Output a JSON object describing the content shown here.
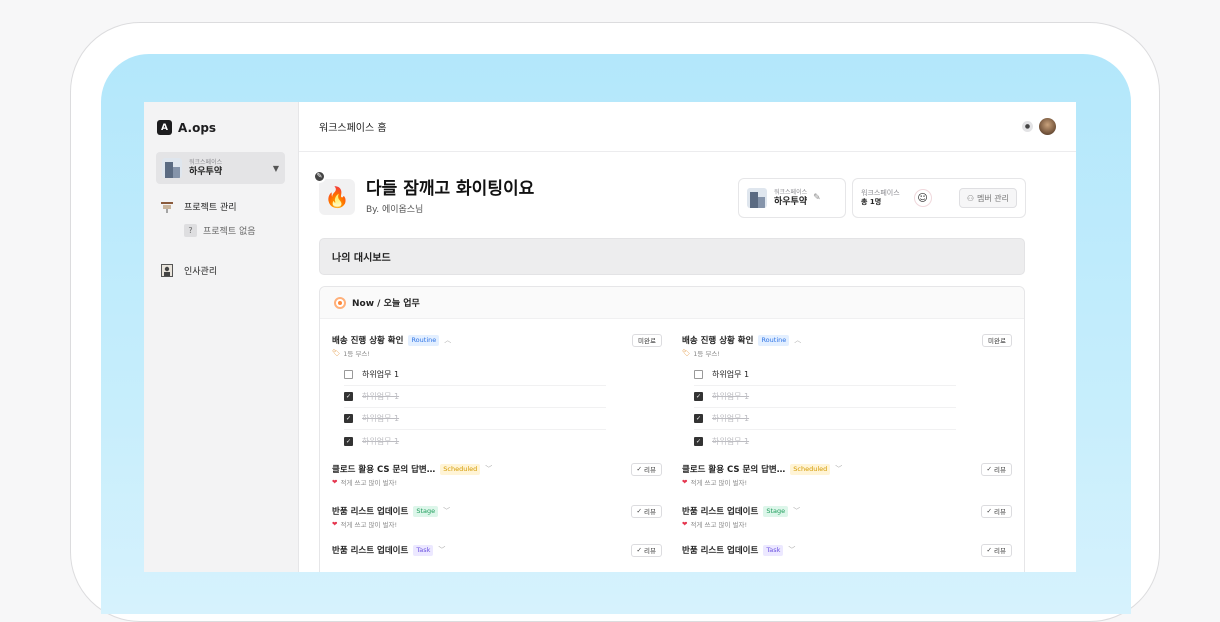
{
  "brand": {
    "name": "A.ops"
  },
  "sidebar": {
    "workspace_label": "워크스페이스",
    "workspace_name": "하우투약",
    "nav": [
      {
        "label": "프로젝트 관리",
        "icon": "project-board-icon"
      },
      {
        "label": "인사관리",
        "icon": "person-frame-icon"
      }
    ],
    "no_project": "프로젝트 없음"
  },
  "topbar": {
    "title": "워크스페이스 홈"
  },
  "hero": {
    "title": "다들 잠깨고 화이팅이요",
    "by": "By. 에이옵스님",
    "emoji": "🔥"
  },
  "workspace_card": {
    "label": "워크스페이스",
    "name": "하우투약"
  },
  "member_card": {
    "label": "워크스페이스",
    "count": "총 1명",
    "button": "멤버 관리"
  },
  "dashboard": {
    "title": "나의 대시보드"
  },
  "now": {
    "title": "Now / 오늘 업무"
  },
  "columns": [
    {
      "tasks": [
        {
          "title": "배송 진행 상황 확인",
          "tag": "Routine",
          "sub": "1등 부스!",
          "button": "미완료",
          "checklist": [
            {
              "label": "하위업무 1",
              "done": false
            },
            {
              "label": "하위업무 1",
              "done": true
            },
            {
              "label": "하위업무 1",
              "done": true
            },
            {
              "label": "하위업무 1",
              "done": true
            }
          ]
        },
        {
          "title": "클로드 활용 CS 문의 답변…",
          "tag": "Scheduled",
          "sub": "적게 쓰고 많이 벌자!",
          "button": "리뷰"
        },
        {
          "title": "반품 리스트 업데이트",
          "tag": "Stage",
          "sub": "적게 쓰고 많이 벌자!",
          "button": "리뷰"
        },
        {
          "title": "반품 리스트 업데이트",
          "tag": "Task",
          "sub": "",
          "button": "리뷰"
        }
      ]
    },
    {
      "tasks": [
        {
          "title": "배송 진행 상황 확인",
          "tag": "Routine",
          "sub": "1등 부스!",
          "button": "미완료",
          "checklist": [
            {
              "label": "하위업무 1",
              "done": false
            },
            {
              "label": "하위업무 1",
              "done": true
            },
            {
              "label": "하위업무 1",
              "done": true
            },
            {
              "label": "하위업무 1",
              "done": true
            }
          ]
        },
        {
          "title": "클로드 활용 CS 문의 답변…",
          "tag": "Scheduled",
          "sub": "적게 쓰고 많이 벌자!",
          "button": "리뷰"
        },
        {
          "title": "반품 리스트 업데이트",
          "tag": "Stage",
          "sub": "적게 쓰고 많이 벌자!",
          "button": "리뷰"
        },
        {
          "title": "반품 리스트 업데이트",
          "tag": "Task",
          "sub": "",
          "button": "리뷰"
        }
      ]
    }
  ]
}
